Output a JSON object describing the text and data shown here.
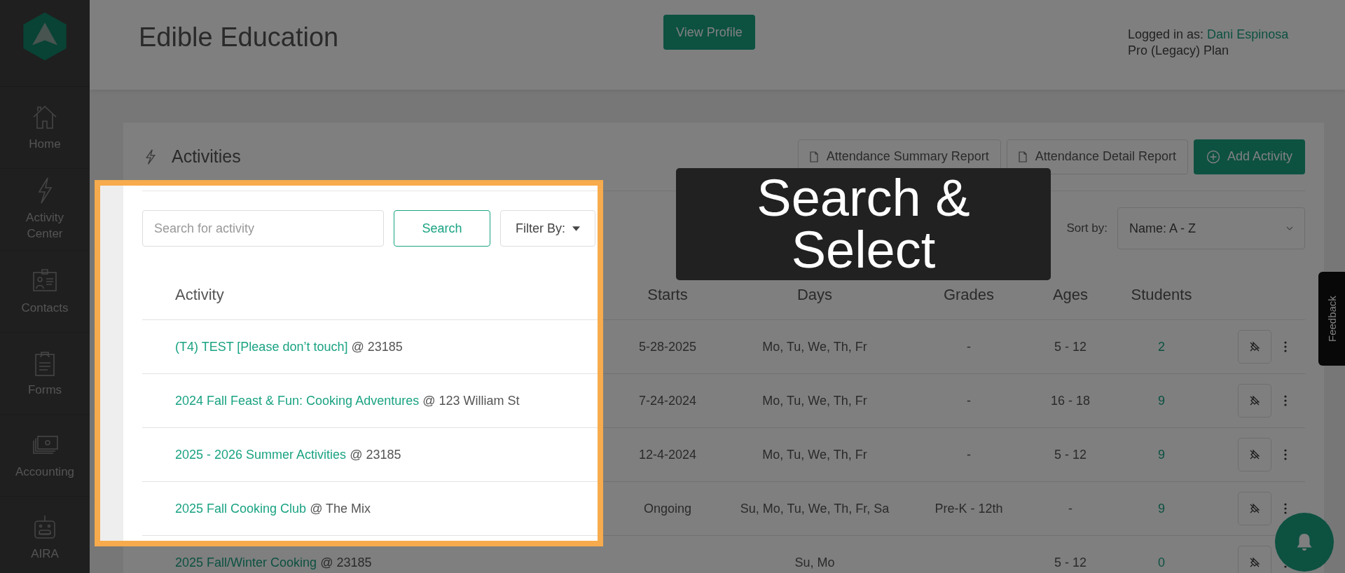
{
  "sidebar": {
    "items": [
      {
        "kind": "home",
        "label": "Home"
      },
      {
        "kind": "activity",
        "label": "Activity Center"
      },
      {
        "kind": "contacts",
        "label": "Contacts"
      },
      {
        "kind": "forms",
        "label": "Forms"
      },
      {
        "kind": "accounting",
        "label": "Accounting"
      },
      {
        "kind": "robot",
        "label": "AIRA"
      }
    ]
  },
  "header": {
    "title": "Edible Education",
    "profile_button": "View Profile",
    "logged_in_label": "Logged in as:",
    "user": "Dani Espinosa",
    "plan": "Pro (Legacy) Plan"
  },
  "activities": {
    "title": "Activities",
    "report_buttons": [
      "Attendance Summary Report",
      "Attendance Detail Report"
    ],
    "add_button": "Add Activity",
    "search": {
      "placeholder": "Search for activity"
    },
    "search_button": "Search",
    "filter": "Filter By:",
    "sort_label": "Sort by:",
    "sort_value": "Name: A - Z",
    "columns": [
      "Activity",
      "Starts",
      "Days",
      "Grades",
      "Ages",
      "Students"
    ],
    "rows": [
      {
        "name": "(T4) TEST [Please don’t touch]",
        "location": "@ 23185",
        "starts": "5-28-2025",
        "days": "Mo, Tu, We, Th, Fr",
        "grades": "-",
        "ages": "5 - 12",
        "students": "2"
      },
      {
        "name": "2024 Fall Feast & Fun: Cooking Adventures",
        "location": "@ 123 William St",
        "starts": "7-24-2024",
        "days": "Mo, Tu, We, Th, Fr",
        "grades": "-",
        "ages": "16 - 18",
        "students": "9"
      },
      {
        "name": "2025 - 2026 Summer Activities",
        "location": "@ 23185",
        "starts": "12-4-2024",
        "days": "Mo, Tu, We, Th, Fr",
        "grades": "-",
        "ages": "5 - 12",
        "students": "9"
      },
      {
        "name": "2025 Fall Cooking Club",
        "location": "@ The Mix",
        "starts": "Ongoing",
        "days": "Su, Mo, Tu, We, Th, Fr, Sa",
        "grades": "Pre-K - 12th",
        "ages": "-",
        "students": "9"
      },
      {
        "name": "2025 Fall/Winter Cooking",
        "location": "@ 23185",
        "days": "Su, Mo",
        "ages": "5 - 12",
        "students": "0"
      }
    ]
  },
  "feedback_tab": "Feedback",
  "overlay": {
    "label": "Search & Select"
  }
}
